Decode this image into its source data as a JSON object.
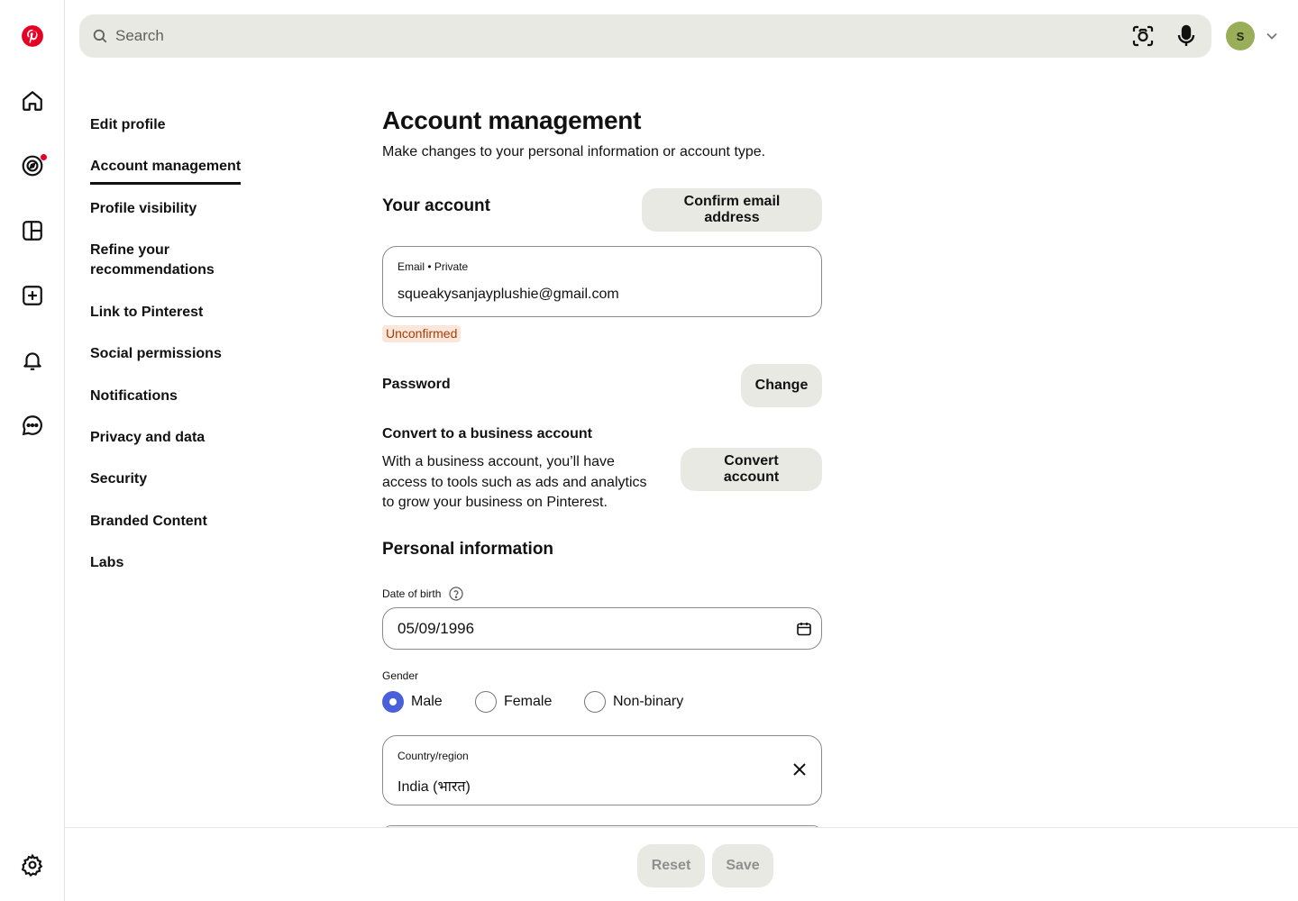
{
  "search": {
    "placeholder": "Search"
  },
  "header": {
    "avatar_initial": "S"
  },
  "settings_nav": {
    "items": [
      {
        "label": "Edit profile"
      },
      {
        "label": "Account management",
        "active": true
      },
      {
        "label": "Profile visibility"
      },
      {
        "label": "Refine your recommendations"
      },
      {
        "label": "Link to Pinterest"
      },
      {
        "label": "Social permissions"
      },
      {
        "label": "Notifications"
      },
      {
        "label": "Privacy and data"
      },
      {
        "label": "Security"
      },
      {
        "label": "Branded Content"
      },
      {
        "label": "Labs"
      }
    ]
  },
  "main": {
    "title": "Account management",
    "subtitle": "Make changes to your personal information or account type.",
    "your_account": {
      "title": "Your account",
      "confirm_email_label": "Confirm email address",
      "email_label": "Email • Private",
      "email_value": "squeakysanjayplushie@gmail.com",
      "status_badge": "Unconfirmed",
      "password_label": "Password",
      "change_label": "Change",
      "convert_title": "Convert to a business account",
      "convert_text": "With a business account, you’ll have access to tools such as ads and analytics to grow your business on Pinterest.",
      "convert_button": "Convert account"
    },
    "personal_info": {
      "title": "Personal information",
      "dob_label": "Date of birth",
      "dob_value": "05/09/1996",
      "gender_label": "Gender",
      "gender_options": [
        "Male",
        "Female",
        "Non-binary"
      ],
      "gender_selected": "Male",
      "country_label": "Country/region",
      "country_value": "India (भारत)"
    }
  },
  "footer": {
    "reset_label": "Reset",
    "save_label": "Save"
  },
  "colors": {
    "brand": "#e60023",
    "accent": "#4a60da",
    "button_bg": "#e9e9e4",
    "avatar_bg": "#9aae5a",
    "badge_bg": "#fbe6d9",
    "badge_text": "#a53e0b"
  }
}
